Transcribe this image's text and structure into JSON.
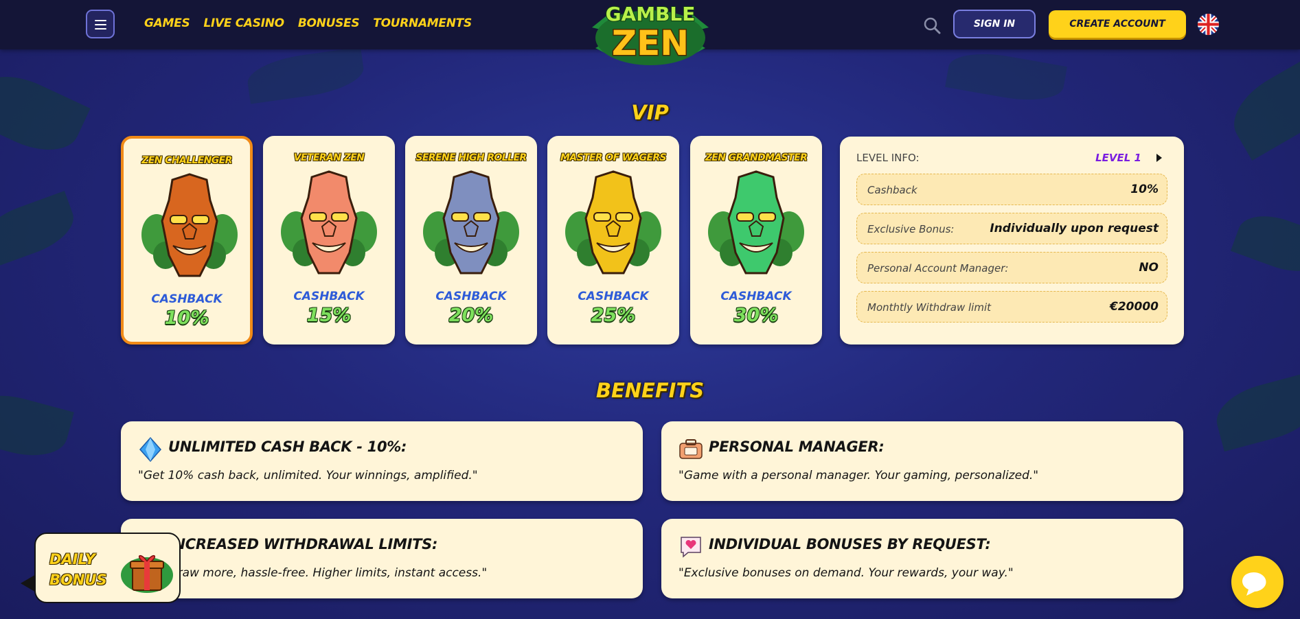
{
  "header": {
    "nav": [
      "GAMES",
      "LIVE CASINO",
      "BONUSES",
      "TOURNAMENTS"
    ],
    "logo_line1": "GAMBLE",
    "logo_line2": "ZEN",
    "sign_in": "SIGN IN",
    "create_account": "CREATE ACCOUNT",
    "language_icon": "uk-flag-icon"
  },
  "vip": {
    "title": "VIP",
    "tiers": [
      {
        "name": "ZEN CHALLENGER",
        "cashback_label": "CASHBACK",
        "cashback": "10%",
        "active": true,
        "mask_color": "#d8661f"
      },
      {
        "name": "VETERAN ZEN",
        "cashback_label": "CASHBACK",
        "cashback": "15%",
        "active": false,
        "mask_color": "#f28a6b"
      },
      {
        "name": "SERENE HIGH ROLLER",
        "cashback_label": "CASHBACK",
        "cashback": "20%",
        "active": false,
        "mask_color": "#7f8fbf"
      },
      {
        "name": "MASTER OF WAGERS",
        "cashback_label": "CASHBACK",
        "cashback": "25%",
        "active": false,
        "mask_color": "#f2c21a"
      },
      {
        "name": "ZEN GRANDMASTER",
        "cashback_label": "CASHBACK",
        "cashback": "30%",
        "active": false,
        "mask_color": "#3ec96d"
      }
    ],
    "level_info": {
      "label": "LEVEL INFO:",
      "value": "LEVEL 1",
      "rows": [
        {
          "key": "Cashback",
          "value": "10%"
        },
        {
          "key": "Exclusive Bonus:",
          "value": "Individually upon request"
        },
        {
          "key": "Personal Account Manager:",
          "value": "NO"
        },
        {
          "key": "Monthtly Withdraw limit",
          "value": "€20000"
        }
      ]
    }
  },
  "benefits": {
    "title": "BENEFITS",
    "items": [
      {
        "icon": "diamond-icon",
        "title": "UNLIMITED CASH BACK - 10%:",
        "desc": "\"Get 10% cash back, unlimited. Your winnings, amplified.\""
      },
      {
        "icon": "manager-icon",
        "title": "PERSONAL MANAGER:",
        "desc": "\"Game with a personal manager. Your gaming, personalized.\""
      },
      {
        "icon": "withdrawal-icon",
        "title": "INCREASED WITHDRAWAL LIMITS:",
        "desc": "\"Withdraw more, hassle-free. Higher limits, instant access.\""
      },
      {
        "icon": "heart-message-icon",
        "title": "INDIVIDUAL BONUSES BY REQUEST:",
        "desc": "\"Exclusive bonuses on demand. Your rewards, your way.\""
      }
    ]
  },
  "daily_bonus": {
    "line1": "DAILY",
    "line2": "BONUS"
  },
  "colors": {
    "accent": "#ffd21a",
    "card": "#fff5d8",
    "active_border": "#f08a17",
    "cashback_text": "#2d5bd8",
    "percent": "#7ee05d",
    "level": "#7a1de0"
  }
}
